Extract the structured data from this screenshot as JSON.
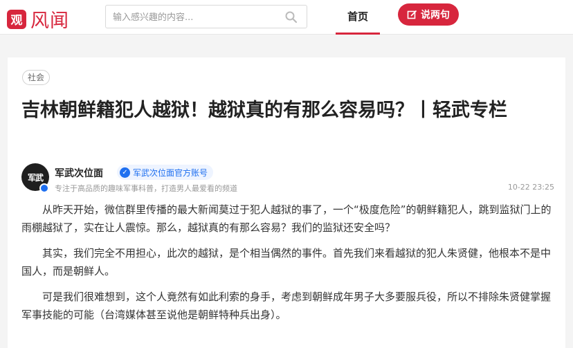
{
  "header": {
    "logo_badge": "观",
    "logo_text": "风闻",
    "search_placeholder": "输入感兴趣的内容...",
    "nav_home": "首页",
    "post_button": "说两句"
  },
  "article": {
    "tag": "社会",
    "title": "吉林朝鲜籍犯人越狱！越狱真的有那么容易吗？丨轻武专栏",
    "author": {
      "avatar_text": "军武",
      "name": "军武次位面",
      "verified_label": "军武次位面官方账号",
      "description": "专注于高品质的趣味军事科普，打造男人最爱看的频道"
    },
    "timestamp": "10-22 23:25",
    "paragraphs": [
      "从昨天开始，微信群里传播的最大新闻莫过于犯人越狱的事了，一个“极度危险”的朝鲜籍犯人，跳到监狱门上的雨棚越狱了，实在让人震惊。那么，越狱真的有那么容易？我们的监狱还安全吗？",
      "其实，我们完全不用担心，此次的越狱，是个相当偶然的事件。首先我们来看越狱的犯人朱贤健，他根本不是中国人，而是朝鲜人。",
      "可是我们很难想到，这个人竟然有如此利索的身手，考虑到朝鲜成年男子大多要服兵役，所以不排除朱贤健掌握军事技能的可能（台湾媒体甚至说他是朝鲜特种兵出身）。"
    ]
  },
  "colors": {
    "brand": "#d7263d",
    "verify": "#1e6ff0"
  },
  "icons": {
    "search": "search-icon",
    "edit": "edit-icon",
    "verify": "verified-check-icon"
  }
}
